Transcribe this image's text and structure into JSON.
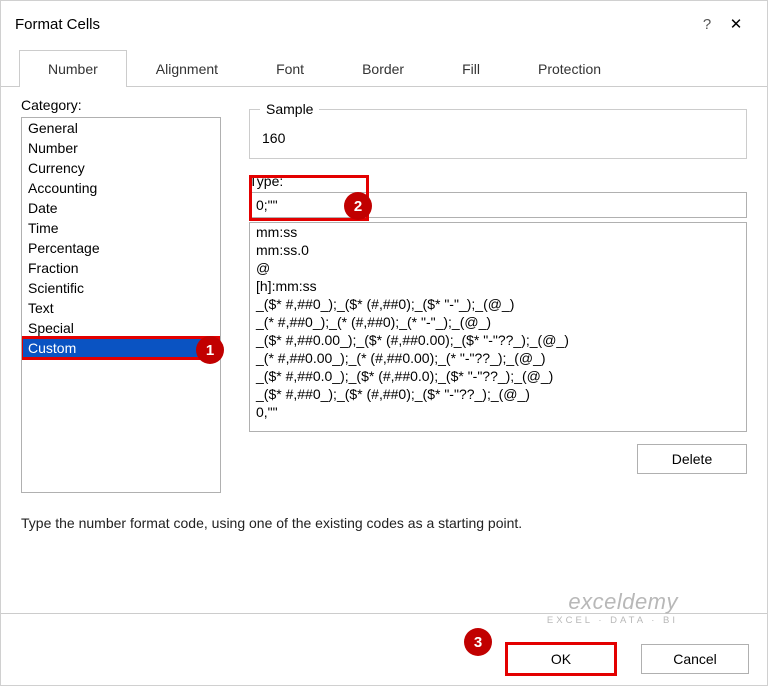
{
  "title": "Format Cells",
  "help": "?",
  "close": "✕",
  "tabs": [
    "Number",
    "Alignment",
    "Font",
    "Border",
    "Fill",
    "Protection"
  ],
  "activeTab": 0,
  "categoryLabel": "Category:",
  "categories": [
    "General",
    "Number",
    "Currency",
    "Accounting",
    "Date",
    "Time",
    "Percentage",
    "Fraction",
    "Scientific",
    "Text",
    "Special",
    "Custom"
  ],
  "selectedCategory": 11,
  "sampleLabel": "Sample",
  "sampleValue": "160",
  "typeLabel": "Type:",
  "typeValue": "0;\"\"",
  "formats": [
    "mm:ss",
    "mm:ss.0",
    "@",
    "[h]:mm:ss",
    "_($* #,##0_);_($* (#,##0);_($* \"-\"_);_(@_)",
    "_(* #,##0_);_(* (#,##0);_(* \"-\"_);_(@_)",
    "_($* #,##0.00_);_($* (#,##0.00);_($* \"-\"??_);_(@_)",
    "_(* #,##0.00_);_(* (#,##0.00);_(* \"-\"??_);_(@_)",
    "_($* #,##0.0_);_($* (#,##0.0);_($* \"-\"??_);_(@_)",
    "_($* #,##0_);_($* (#,##0);_($* \"-\"??_);_(@_)",
    "0,\"\""
  ],
  "deleteBtn": "Delete",
  "hint": "Type the number format code, using one of the existing codes as a starting point.",
  "okBtn": "OK",
  "cancelBtn": "Cancel",
  "watermarkBig": "exceldemy",
  "watermarkSmall": "EXCEL · DATA · BI",
  "callouts": {
    "c1": "1",
    "c2": "2",
    "c3": "3"
  }
}
